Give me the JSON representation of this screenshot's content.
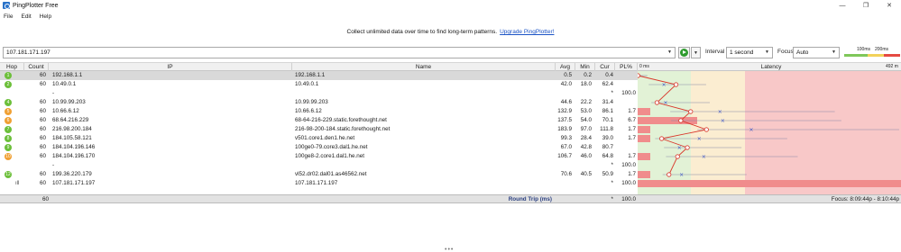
{
  "window": {
    "title": "PingPlotter Free",
    "minimize": "—",
    "restore": "❐",
    "close": "✕"
  },
  "menu": [
    "File",
    "Edit",
    "Help"
  ],
  "promo": {
    "text": "Collect unlimited data over time to find long-term patterns.",
    "link": "Upgrade PingPlotter!"
  },
  "toolbar": {
    "target": "107.181.171.197",
    "interval_label": "Interval",
    "interval_value": "1 second",
    "focus_label": "Focus",
    "focus_value": "Auto",
    "scale_100": "100ms",
    "scale_200": "200ms"
  },
  "columns": {
    "hop": "Hop",
    "count": "Count",
    "ip": "IP",
    "name": "Name",
    "avg": "Avg",
    "min": "Min",
    "cur": "Cur",
    "pl": "PL%",
    "graph_min": "0 ms",
    "latency": "Latency",
    "graph_max": "492 m"
  },
  "hops": [
    {
      "hop": "1",
      "count": "60",
      "ip": "192.168.1.1",
      "name": "192.168.1.1",
      "avg": "0.5",
      "min": "0.2",
      "cur": "0.4",
      "pl": "",
      "color": "green",
      "selected": true,
      "plbar": 0
    },
    {
      "hop": "2",
      "count": "60",
      "ip": "10.49.0.1",
      "name": "10.49.0.1",
      "avg": "42.0",
      "min": "18.0",
      "cur": "62.4",
      "pl": "",
      "color": "green",
      "selected": false,
      "plbar": 0
    },
    {
      "hop": "",
      "count": "",
      "ip": "-",
      "name": "",
      "avg": "",
      "min": "",
      "cur": "*",
      "pl": "100.0",
      "color": "",
      "selected": false,
      "plbar": 0
    },
    {
      "hop": "4",
      "count": "60",
      "ip": "10.99.99.203",
      "name": "10.99.99.203",
      "avg": "44.6",
      "min": "22.2",
      "cur": "31.4",
      "pl": "",
      "color": "green",
      "selected": false,
      "plbar": 0
    },
    {
      "hop": "5",
      "count": "60",
      "ip": "10.66.6.12",
      "name": "10.66.6.12",
      "avg": "132.9",
      "min": "53.0",
      "cur": "86.1",
      "pl": "1.7",
      "color": "orange",
      "selected": false,
      "plbar": 1
    },
    {
      "hop": "6",
      "count": "60",
      "ip": "68.64.216.229",
      "name": "68-64-216-229.static.forethought.net",
      "avg": "137.5",
      "min": "54.0",
      "cur": "70.1",
      "pl": "6.7",
      "color": "orange",
      "selected": false,
      "plbar": 2
    },
    {
      "hop": "7",
      "count": "60",
      "ip": "216.98.200.184",
      "name": "216-98-200-184.static.forethought.net",
      "avg": "183.9",
      "min": "97.0",
      "cur": "111.8",
      "pl": "1.7",
      "color": "green",
      "selected": false,
      "plbar": 1
    },
    {
      "hop": "8",
      "count": "60",
      "ip": "184.105.58.121",
      "name": "v501.core1.den1.he.net",
      "avg": "99.3",
      "min": "28.4",
      "cur": "39.0",
      "pl": "1.7",
      "color": "green",
      "selected": false,
      "plbar": 1
    },
    {
      "hop": "9",
      "count": "60",
      "ip": "184.104.196.146",
      "name": "100ge0-79.core3.dal1.he.net",
      "avg": "67.0",
      "min": "42.8",
      "cur": "80.7",
      "pl": "",
      "color": "green",
      "selected": false,
      "plbar": 0
    },
    {
      "hop": "10",
      "count": "60",
      "ip": "184.104.196.170",
      "name": "100ge8-2.core1.dal1.he.net",
      "avg": "106.7",
      "min": "46.0",
      "cur": "64.8",
      "pl": "1.7",
      "color": "orange",
      "selected": false,
      "plbar": 1
    },
    {
      "hop": "",
      "count": "",
      "ip": "-",
      "name": "",
      "avg": "",
      "min": "",
      "cur": "*",
      "pl": "100.0",
      "color": "",
      "selected": false,
      "plbar": 0
    },
    {
      "hop": "12",
      "count": "60",
      "ip": "199.36.220.179",
      "name": "vl52.dr02.dal01.as46562.net",
      "avg": "70.6",
      "min": "40.5",
      "cur": "50.9",
      "pl": "1.7",
      "color": "green",
      "selected": false,
      "plbar": 1
    },
    {
      "hop": "",
      "count": "60",
      "ip": "107.181.171.197",
      "name": "107.181.171.197",
      "avg": "",
      "min": "",
      "cur": "*",
      "pl": "100.0",
      "color": "bars",
      "selected": false,
      "plbar": 3
    }
  ],
  "summary": {
    "count": "60",
    "label": "Round Trip (ms)",
    "cur": "*",
    "pl": "100.0",
    "focus": "Focus: 8:09:44p - 8:10:44p"
  },
  "colors": {
    "zone_green": "#e2f2d6",
    "zone_yellow": "#fbedd1",
    "zone_red": "#f8c8c8",
    "trace": "#d9382c",
    "avg_marker": "#3b56c8",
    "pl_bar": "#f08c8c"
  },
  "grip": "•••"
}
